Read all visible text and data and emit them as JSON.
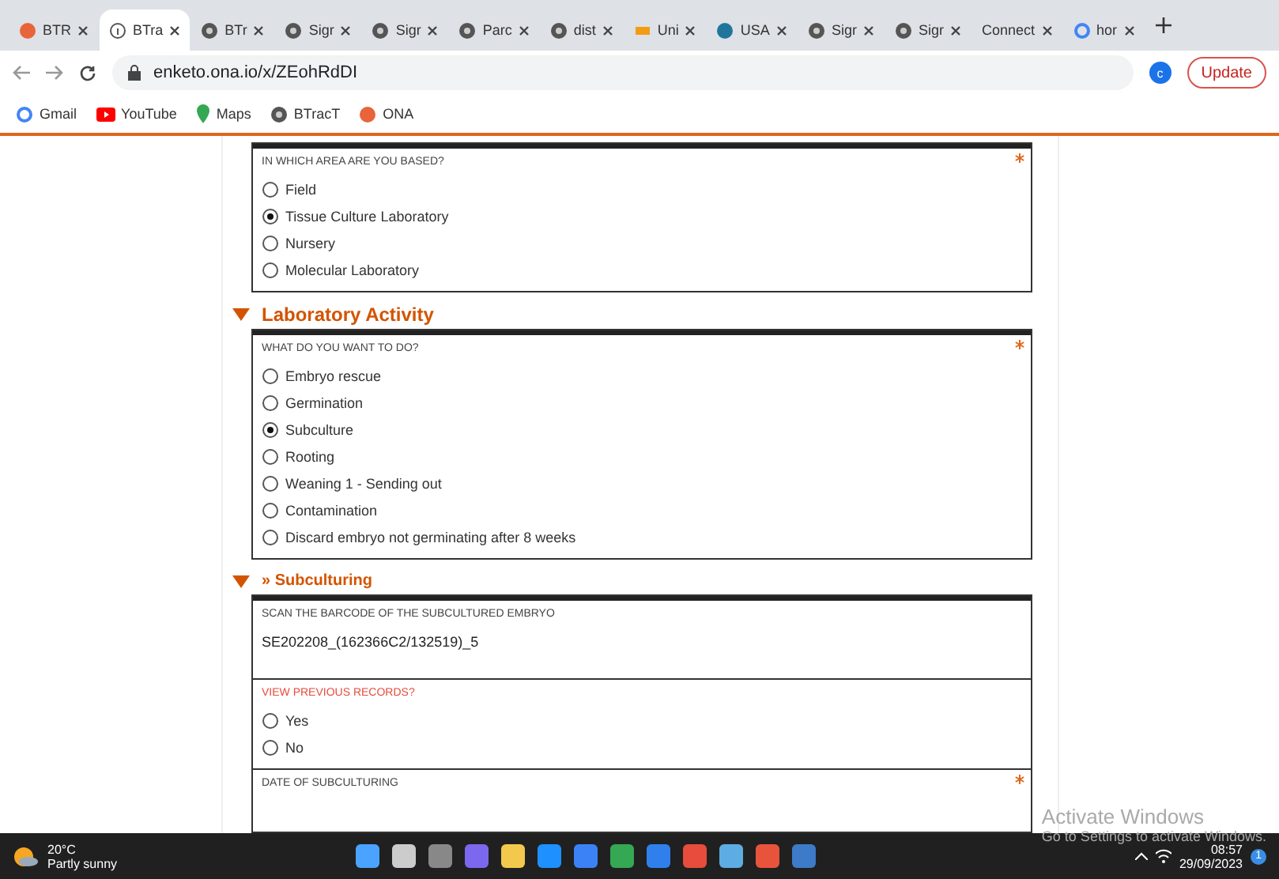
{
  "browser": {
    "tabs": [
      {
        "title": "BTR",
        "selected": false
      },
      {
        "title": "BTra",
        "selected": true
      },
      {
        "title": "BTr",
        "selected": false
      },
      {
        "title": "Sigr",
        "selected": false
      },
      {
        "title": "Sigr",
        "selected": false
      },
      {
        "title": "Parc",
        "selected": false
      },
      {
        "title": "dist",
        "selected": false
      },
      {
        "title": "Uni",
        "selected": false
      },
      {
        "title": "USA",
        "selected": false
      },
      {
        "title": "Sigr",
        "selected": false
      },
      {
        "title": "Sigr",
        "selected": false
      },
      {
        "title": "Connect",
        "selected": false
      },
      {
        "title": "hor",
        "selected": false
      }
    ],
    "url": "enketo.ona.io/x/ZEohRdDI",
    "profile": "c",
    "update_label": "Update",
    "bookmarks": [
      {
        "label": "Gmail"
      },
      {
        "label": "YouTube"
      },
      {
        "label": "Maps"
      },
      {
        "label": "BTracT"
      },
      {
        "label": "ONA"
      }
    ]
  },
  "form": {
    "groups": [
      {
        "questions": [
          {
            "kind": "radio",
            "label": "IN WHICH AREA ARE YOU BASED?",
            "required": true,
            "options": [
              {
                "label": "Field",
                "selected": false
              },
              {
                "label": "Tissue Culture Laboratory",
                "selected": true
              },
              {
                "label": "Nursery",
                "selected": false
              },
              {
                "label": "Molecular Laboratory",
                "selected": false
              }
            ]
          }
        ]
      },
      {
        "heading": "Laboratory Activity",
        "questions": [
          {
            "kind": "radio",
            "label": "WHAT DO YOU WANT TO DO?",
            "required": true,
            "options": [
              {
                "label": "Embryo rescue",
                "selected": false
              },
              {
                "label": "Germination",
                "selected": false
              },
              {
                "label": "Subculture",
                "selected": true
              },
              {
                "label": "Rooting",
                "selected": false
              },
              {
                "label": "Weaning 1 - Sending out",
                "selected": false
              },
              {
                "label": "Contamination",
                "selected": false
              },
              {
                "label": "Discard embryo not germinating after 8 weeks",
                "selected": false
              }
            ]
          }
        ]
      },
      {
        "heading": "» Subculturing",
        "questions": [
          {
            "kind": "text",
            "label": "SCAN THE BARCODE OF THE SUBCULTURED EMBRYO",
            "required": false,
            "value": "SE202208_(162366C2/132519)_5"
          },
          {
            "kind": "radio",
            "label": "VIEW PREVIOUS RECORDS?",
            "required": false,
            "options": [
              {
                "label": "Yes",
                "selected": false
              },
              {
                "label": "No",
                "selected": false
              }
            ]
          },
          {
            "kind": "date",
            "label": "DATE OF SUBCULTURING",
            "required": true
          }
        ]
      }
    ]
  },
  "activation": {
    "title": "Activate Windows",
    "subtitle": "Go to Settings to activate Windows."
  },
  "taskbar": {
    "temperature": "20°C",
    "weather": "Partly sunny",
    "time": "08:57",
    "date": "29/09/2023",
    "notifications": "1"
  }
}
